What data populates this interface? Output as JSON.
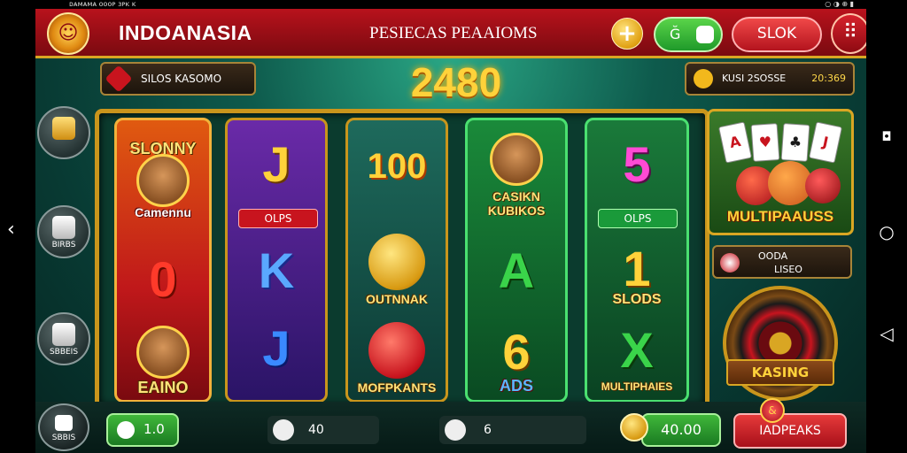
{
  "status_bar": {
    "left": "ᴅᴀᴍᴀᴍᴀ ᴏᴏᴏᴘ ɜᴘᴋ ᴋ",
    "right": "○ ◑ ⊕ ▮"
  },
  "header": {
    "brand": "INDOANASIA",
    "game_title": "PESIECAS PEAAIOMS",
    "plus_label": "+",
    "green_button_label": "Ğ",
    "slok_label": "SLOK",
    "menu_label": "⠿"
  },
  "info_left": {
    "label": "SILOS KASOMO"
  },
  "jackpot": {
    "value": "2480"
  },
  "info_right": {
    "label": "KUSI 2SOSSE",
    "value": "20:369"
  },
  "side_buttons": [
    {
      "label": ""
    },
    {
      "label": "BIRBS"
    },
    {
      "label": "SBBEIS"
    }
  ],
  "reels": [
    {
      "top_label": "SLONNY",
      "top_sub": "Camennu",
      "mid_symbol": "0",
      "bottom_label": "EAINO"
    },
    {
      "top_symbol": "J",
      "pill": "OLPS",
      "mid_symbol": "K",
      "bottom_symbol": "J"
    },
    {
      "top_symbol": "100",
      "mid_label": "OUTNNAK",
      "bottom_label": "MOFPKANTS"
    },
    {
      "top_label": "CASIKN",
      "top_sub": "KUBIKOS",
      "mid_symbol": "A",
      "bottom_symbol": "6",
      "bottom_label": "ADS"
    },
    {
      "top_symbol": "5",
      "pill": "OLPS",
      "mid_symbol": "1",
      "mid_label": "SLODS",
      "bottom_symbol": "X",
      "bottom_label": "MULTIPHAIES"
    }
  ],
  "right_panel": {
    "card_title": "MULTIPAAUSS",
    "cards": [
      "A",
      "♥",
      "♣",
      "J"
    ],
    "info_line1": "OODA",
    "info_line2": "LISEO",
    "roulette_label": "KASING"
  },
  "bottom_bar": {
    "home_label": "SBBIS",
    "green_value": "1.0",
    "field1_value": "40",
    "field2_value": "6",
    "balance": "40.00",
    "red_label": "IADPEAKS"
  },
  "android_nav": {
    "back": "‹",
    "home": "○",
    "recents": "◁"
  },
  "colors": {
    "header_red": "#b8121c",
    "gold": "#d9a623",
    "jackpot": "#ffd23a",
    "table_green": "#0e5a4c"
  }
}
